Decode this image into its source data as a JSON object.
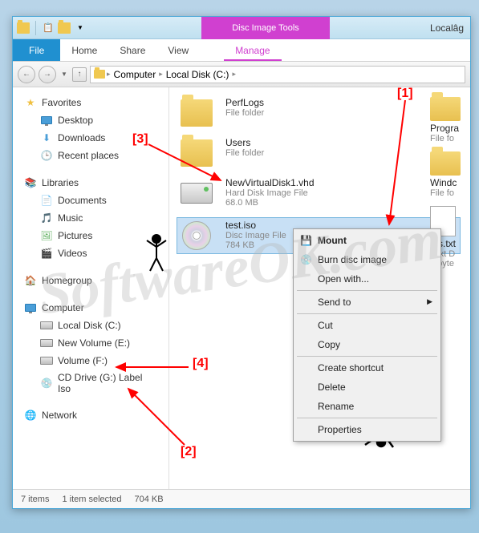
{
  "titlebar": {
    "tool_tab": "Disc Image Tools",
    "window_title": "Localâg"
  },
  "ribbon": {
    "file": "File",
    "home": "Home",
    "share": "Share",
    "view": "View",
    "manage": "Manage"
  },
  "address": {
    "p1": "Computer",
    "p2": "Local Disk (C:)"
  },
  "sidebar": {
    "favorites": {
      "label": "Favorites",
      "items": [
        "Desktop",
        "Downloads",
        "Recent places"
      ]
    },
    "libraries": {
      "label": "Libraries",
      "items": [
        "Documents",
        "Music",
        "Pictures",
        "Videos"
      ]
    },
    "homegroup": "Homegroup",
    "computer": {
      "label": "Computer",
      "items": [
        "Local Disk (C:)",
        "New Volume (E:)",
        "Volume (F:)",
        "CD Drive (G:) Label Iso"
      ]
    },
    "network": "Network"
  },
  "files": {
    "f1": {
      "name": "PerfLogs",
      "sub": "File folder"
    },
    "f2": {
      "name": "Users",
      "sub": "File folder"
    },
    "f3": {
      "name": "NewVirtualDisk1.vhd",
      "sub": "Hard Disk Image File",
      "sub2": "68.0 MB"
    },
    "f4": {
      "name": "test.iso",
      "sub": "Disc Image File",
      "sub2": "784 KB"
    },
    "r1": {
      "name": "Progra",
      "sub": "File fo"
    },
    "r2": {
      "name": "Windc",
      "sub": "File fo"
    },
    "r3": {
      "name": "tes.txt",
      "sub": "Text D",
      "sub2": "0 byte"
    }
  },
  "context_menu": {
    "mount": "Mount",
    "burn": "Burn disc image",
    "open_with": "Open with...",
    "send_to": "Send to",
    "cut": "Cut",
    "copy": "Copy",
    "shortcut": "Create shortcut",
    "delete": "Delete",
    "rename": "Rename",
    "properties": "Properties"
  },
  "status": {
    "count": "7 items",
    "sel": "1 item selected",
    "size": "704 KB"
  },
  "annotations": {
    "a1": "[1]",
    "a2": "[2]",
    "a3": "[3]",
    "a4": "[4]"
  },
  "watermark": "SoftwareOK.com"
}
